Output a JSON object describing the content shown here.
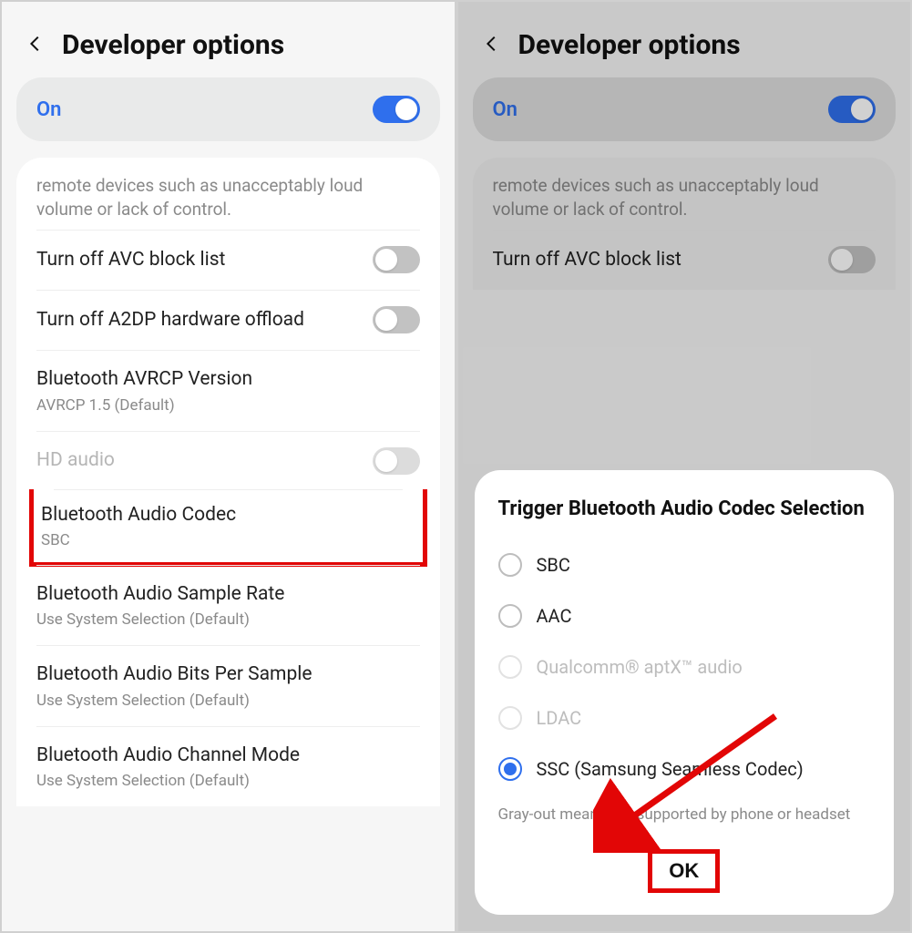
{
  "left": {
    "title": "Developer options",
    "on_label": "On",
    "hint": "remote devices such as unacceptably loud volume or lack of control.",
    "rows": {
      "avc": {
        "label": "Turn off AVC block list"
      },
      "a2dp": {
        "label": "Turn off A2DP hardware offload"
      },
      "avrcp": {
        "label": "Bluetooth AVRCP Version",
        "sub": "AVRCP 1.5 (Default)"
      },
      "hd": {
        "label": "HD audio"
      },
      "codec": {
        "label": "Bluetooth Audio Codec",
        "sub": "SBC"
      },
      "sample": {
        "label": "Bluetooth Audio Sample Rate",
        "sub": "Use System Selection (Default)"
      },
      "bits": {
        "label": "Bluetooth Audio Bits Per Sample",
        "sub": "Use System Selection (Default)"
      },
      "channel": {
        "label": "Bluetooth Audio Channel Mode",
        "sub": "Use System Selection (Default)"
      }
    }
  },
  "right": {
    "title": "Developer options",
    "on_label": "On",
    "hint": "remote devices such as unacceptably loud volume or lack of control.",
    "rows": {
      "avc": {
        "label": "Turn off AVC block list"
      }
    },
    "dialog": {
      "title": "Trigger Bluetooth Audio Codec Selection",
      "options": {
        "sbc": "SBC",
        "aac": "AAC",
        "aptx": "Qualcomm® aptX™ audio",
        "ldac": "LDAC",
        "ssc": "SSC (Samsung Seamless Codec)"
      },
      "hint": "Gray-out means not supported by phone or headset",
      "ok": "OK"
    }
  }
}
